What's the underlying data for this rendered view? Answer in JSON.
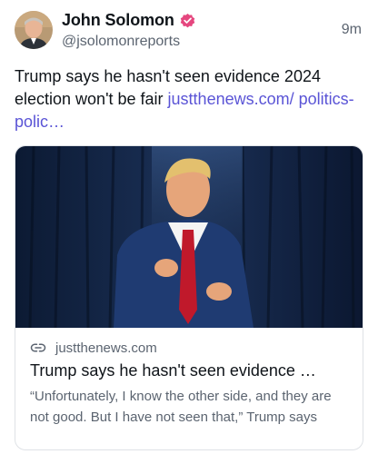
{
  "post": {
    "author": {
      "display_name": "John Solomon",
      "handle": "@jsolomonreports",
      "avatar_icon": "avatar-photo",
      "verified_icon": "verified-badge-icon",
      "verified_color": "#e5477f"
    },
    "timestamp": "9m",
    "text": "Trump says he hasn't seen evidence 2024 election won't be fair",
    "link_text": "justthenews.com/ politics-polic…",
    "link_color": "#5a54d6"
  },
  "link_card": {
    "domain": "justthenews.com",
    "link_icon": "link-icon",
    "title": "Trump says he hasn't seen evidence …",
    "description": "“Unfortunately, I know the other side, and they are not good. But I have not seen that,” Trump says"
  }
}
